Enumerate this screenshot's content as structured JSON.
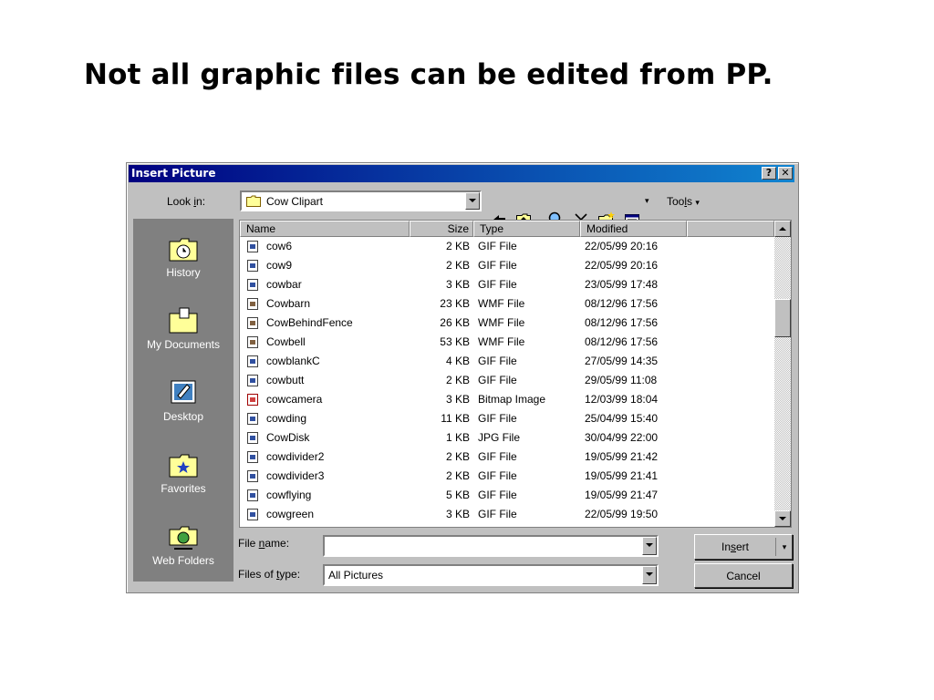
{
  "slide": {
    "title": "Not all graphic files can be edited from PP."
  },
  "dialog": {
    "title": "Insert Picture",
    "help_glyph": "?",
    "close_glyph": "✕",
    "look_in": {
      "label_pre": "Look ",
      "label_u": "i",
      "label_post": "n:",
      "value": "Cow Clipart"
    },
    "tools": {
      "label_pre": "Too",
      "label_u": "l",
      "label_post": "s",
      "caret": "▾",
      "views_caret": "▾"
    },
    "places": [
      {
        "label": "History",
        "icon": "history-icon"
      },
      {
        "label": "My Documents",
        "icon": "my-documents-icon"
      },
      {
        "label": "Desktop",
        "icon": "desktop-icon"
      },
      {
        "label": "Favorites",
        "icon": "favorites-icon"
      },
      {
        "label": "Web Folders",
        "icon": "web-folders-icon"
      }
    ],
    "columns": {
      "name": "Name",
      "size": "Size",
      "type": "Type",
      "modified": "Modified"
    },
    "files": [
      {
        "name": "cow6",
        "size": "2 KB",
        "type": "GIF File",
        "modified": "22/05/99 20:16",
        "kind": "gif"
      },
      {
        "name": "cow9",
        "size": "2 KB",
        "type": "GIF File",
        "modified": "22/05/99 20:16",
        "kind": "gif"
      },
      {
        "name": "cowbar",
        "size": "3 KB",
        "type": "GIF File",
        "modified": "23/05/99 17:48",
        "kind": "gif"
      },
      {
        "name": "Cowbarn",
        "size": "23 KB",
        "type": "WMF File",
        "modified": "08/12/96 17:56",
        "kind": "wmf"
      },
      {
        "name": "CowBehindFence",
        "size": "26 KB",
        "type": "WMF File",
        "modified": "08/12/96 17:56",
        "kind": "wmf"
      },
      {
        "name": "Cowbell",
        "size": "53 KB",
        "type": "WMF File",
        "modified": "08/12/96 17:56",
        "kind": "wmf"
      },
      {
        "name": "cowblankC",
        "size": "4 KB",
        "type": "GIF File",
        "modified": "27/05/99 14:35",
        "kind": "gif"
      },
      {
        "name": "cowbutt",
        "size": "2 KB",
        "type": "GIF File",
        "modified": "29/05/99 11:08",
        "kind": "gif"
      },
      {
        "name": "cowcamera",
        "size": "3 KB",
        "type": "Bitmap Image",
        "modified": "12/03/99 18:04",
        "kind": "bmp"
      },
      {
        "name": "cowding",
        "size": "11 KB",
        "type": "GIF File",
        "modified": "25/04/99 15:40",
        "kind": "gif"
      },
      {
        "name": "CowDisk",
        "size": "1 KB",
        "type": "JPG File",
        "modified": "30/04/99 22:00",
        "kind": "gif"
      },
      {
        "name": "cowdivider2",
        "size": "2 KB",
        "type": "GIF File",
        "modified": "19/05/99 21:42",
        "kind": "gif"
      },
      {
        "name": "cowdivider3",
        "size": "2 KB",
        "type": "GIF File",
        "modified": "19/05/99 21:41",
        "kind": "gif"
      },
      {
        "name": "cowflying",
        "size": "5 KB",
        "type": "GIF File",
        "modified": "19/05/99 21:47",
        "kind": "gif"
      },
      {
        "name": "cowgreen",
        "size": "3 KB",
        "type": "GIF File",
        "modified": "22/05/99 19:50",
        "kind": "gif"
      }
    ],
    "file_name": {
      "label_pre": "File ",
      "label_u": "n",
      "label_post": "ame:",
      "value": ""
    },
    "files_of_type": {
      "label_pre": "Files of ",
      "label_u": "t",
      "label_post": "ype:",
      "value": "All Pictures"
    },
    "insert_button": {
      "pre": "In",
      "u": "s",
      "post": "ert",
      "caret": "▾"
    },
    "cancel_button": "Cancel"
  }
}
